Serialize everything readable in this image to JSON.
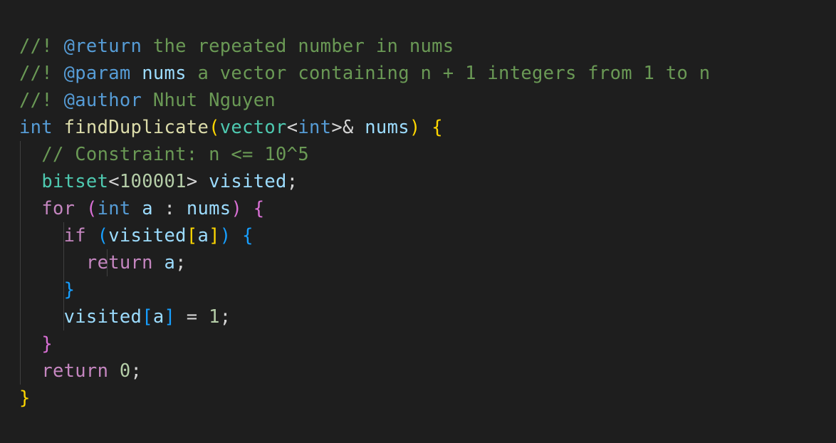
{
  "colors": {
    "background": "#1e1e1e",
    "comment": "#6a9955",
    "doc_tag": "#569cd6",
    "param_name": "#9cdcfe",
    "keyword": "#569cd6",
    "control_keyword": "#c586c0",
    "function": "#dcdcaa",
    "type": "#4ec9b0",
    "variable": "#9cdcfe",
    "number": "#b5cea8",
    "bracket_level_1": "#ffd700",
    "bracket_level_2": "#da70d6",
    "bracket_level_3": "#179fff",
    "indent_guide": "#404040"
  },
  "code": {
    "line1": {
      "prefix": "//! ",
      "tag": "@return",
      "text": " the repeated number in nums"
    },
    "line2": {
      "prefix": "//! ",
      "tag": "@param",
      "space": " ",
      "name": "nums",
      "text": " a vector containing n + 1 integers from 1 to n"
    },
    "line3": {
      "prefix": "//! ",
      "tag": "@author",
      "text": " Nhut Nguyen"
    },
    "line4": {
      "ret_type": "int",
      "space1": " ",
      "func_name": "findDuplicate",
      "paren_open": "(",
      "param_type": "vector",
      "lt": "<",
      "inner_type": "int",
      "gt_amp": ">&",
      "space2": " ",
      "param_name": "nums",
      "paren_close": ")",
      "space3": " ",
      "brace_open": "{"
    },
    "line5": {
      "comment": "// Constraint: n <= 10^5"
    },
    "line6": {
      "type": "bitset",
      "lt": "<",
      "size": "100001",
      "gt": ">",
      "space": " ",
      "var": "visited",
      "semi": ";"
    },
    "line7": {
      "keyword": "for",
      "space1": " ",
      "paren_open": "(",
      "type": "int",
      "space2": " ",
      "var": "a",
      "colon": " : ",
      "range": "nums",
      "paren_close": ")",
      "space3": " ",
      "brace_open": "{"
    },
    "line8": {
      "keyword": "if",
      "space1": " ",
      "paren_open": "(",
      "var": "visited",
      "bracket_open": "[",
      "index": "a",
      "bracket_close": "]",
      "paren_close": ")",
      "space2": " ",
      "brace_open": "{"
    },
    "line9": {
      "keyword": "return",
      "space": " ",
      "var": "a",
      "semi": ";"
    },
    "line10": {
      "brace_close": "}"
    },
    "line11": {
      "var": "visited",
      "bracket_open": "[",
      "index": "a",
      "bracket_close": "]",
      "assign": " = ",
      "value": "1",
      "semi": ";"
    },
    "line12": {
      "brace_close": "}"
    },
    "line13": {
      "keyword": "return",
      "space": " ",
      "value": "0",
      "semi": ";"
    },
    "line14": {
      "brace_close": "}"
    }
  }
}
